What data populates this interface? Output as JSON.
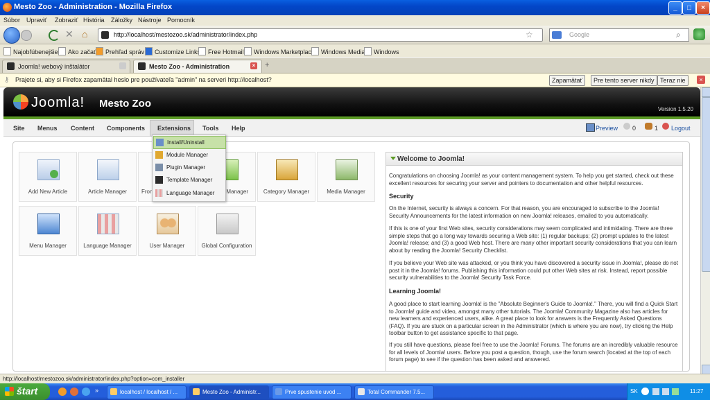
{
  "window": {
    "title": "Mesto Zoo - Administration - Mozilla Firefox"
  },
  "menubar": [
    "Súbor",
    "Upraviť",
    "Zobraziť",
    "História",
    "Záložky",
    "Nástroje",
    "Pomocník"
  ],
  "navbar": {
    "url": "http://localhost/mestozoo.sk/administrator/index.php",
    "search_placeholder": "Google"
  },
  "bookmarks": [
    "Najobľúbenejšie",
    "Ako začať",
    "Prehľad správ",
    "Customize Links",
    "Free Hotmail",
    "Windows Marketplace",
    "Windows Media",
    "Windows"
  ],
  "tabs": [
    {
      "label": "Joomla! webový inštalátor"
    },
    {
      "label": "Mesto Zoo - Administration"
    }
  ],
  "password_bar": {
    "message": "Prajete si, aby si Firefox zapamätal heslo pre používateľa \"admin\" na serveri http://localhost?",
    "remember": "Zapamätať",
    "never": "Pre tento server nikdy",
    "not_now": "Teraz nie"
  },
  "joomla": {
    "logo": "Joomla!",
    "site_name": "Mesto Zoo",
    "version": "Version 1.5.20",
    "menu": [
      "Site",
      "Menus",
      "Content",
      "Components",
      "Extensions",
      "Tools",
      "Help"
    ],
    "right": {
      "preview": "Preview",
      "messages": "0",
      "users": "1",
      "logout": "Logout"
    }
  },
  "dropdown": [
    "Install/Uninstall",
    "Module Manager",
    "Plugin Manager",
    "Template Manager",
    "Language Manager"
  ],
  "cards": [
    {
      "label": "Add New Article",
      "icon": "add-article-icon"
    },
    {
      "label": "Article Manager",
      "icon": "article-manager-icon"
    },
    {
      "label": "Fron",
      "icon": "frontpage-manager-icon"
    },
    {
      "label": "Manager",
      "icon": "section-manager-icon"
    },
    {
      "label": "Category Manager",
      "icon": "category-manager-icon"
    },
    {
      "label": "Media Manager",
      "icon": "media-manager-icon"
    },
    {
      "label": "Menu Manager",
      "icon": "menu-manager-icon"
    },
    {
      "label": "Language Manager",
      "icon": "language-manager-icon"
    },
    {
      "label": "User Manager",
      "icon": "user-manager-icon"
    },
    {
      "label": "Global Configuration",
      "icon": "global-configuration-icon"
    }
  ],
  "welcome": {
    "title": "Welcome to Joomla!",
    "intro": "Congratulations on choosing Joomla! as your content management system. To help you get started, check out these excellent resources for securing your server and pointers to documentation and other helpful resources.",
    "security_heading": "Security",
    "security_p1": "On the Internet, security is always a concern. For that reason, you are encouraged to subscribe to the Joomla! Security Announcements for the latest information on new Joomla! releases, emailed to you automatically.",
    "security_p2": "If this is one of your first Web sites, security considerations may seem complicated and intimidating. There are three simple steps that go a long way towards securing a Web site: (1) regular backups; (2) prompt updates to the latest Joomla! release; and (3) a good Web host. There are many other important security considerations that you can learn about by reading the Joomla! Security Checklist.",
    "security_p3": "If you believe your Web site was attacked, or you think you have discovered a security issue in Joomla!, please do not post it in the Joomla! forums. Publishing this information could put other Web sites at risk. Instead, report possible security vulnerabilities to the Joomla! Security Task Force.",
    "learning_heading": "Learning Joomla!",
    "learning_p1": "A good place to start learning Joomla! is the \"Absolute Beginner's Guide to Joomla!.\" There, you will find a Quick Start to Joomla! guide and video, amongst many other tutorials. The Joomla! Community Magazine also has articles for new learners and experienced users, alike. A great place to look for answers is the Frequently Asked Questions (FAQ). If you are stuck on a particular screen in the Administrator (which is where you are now), try clicking the Help toolbar button to get assistance specific to that page.",
    "learning_p2": "If you still have questions, please feel free to use the Joomla! Forums. The forums are an incredibly valuable resource for all levels of Joomla! users. Before you post a question, though, use the forum search (located at the top of each forum page) to see if the question has been asked and answered."
  },
  "status": "http://localhost/mestozoo.sk/administrator/index.php?option=com_installer",
  "taskbar": {
    "start": "štart",
    "tasks": [
      "localhost / localhost / ...",
      "Mesto Zoo - Administr...",
      "Prve spustenie uvod ...",
      "Total Commander 7.5..."
    ],
    "lang": "SK",
    "time": "11:27"
  }
}
